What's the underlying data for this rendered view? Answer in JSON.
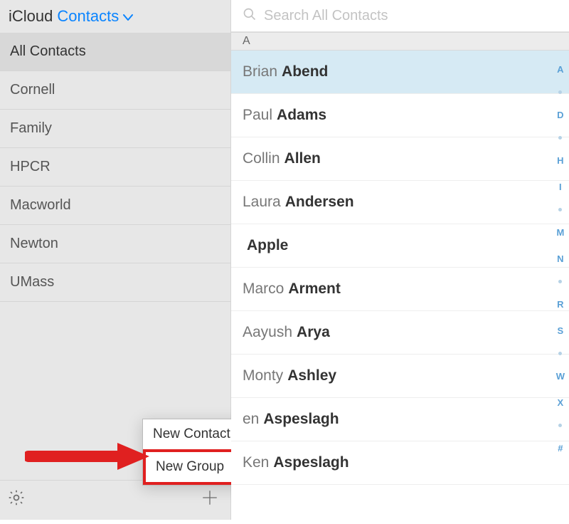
{
  "header": {
    "service": "iCloud",
    "app": "Contacts"
  },
  "search": {
    "placeholder": "Search All Contacts"
  },
  "sidebar": {
    "items": [
      {
        "label": "All Contacts"
      },
      {
        "label": "Cornell"
      },
      {
        "label": "Family"
      },
      {
        "label": "HPCR"
      },
      {
        "label": "Macworld"
      },
      {
        "label": "Newton"
      },
      {
        "label": "UMass"
      }
    ]
  },
  "section_letter": "A",
  "contacts": [
    {
      "first": "Brian",
      "last": "Abend"
    },
    {
      "first": "Paul",
      "last": "Adams"
    },
    {
      "first": "Collin",
      "last": "Allen"
    },
    {
      "first": "Laura",
      "last": "Andersen"
    },
    {
      "first": "",
      "last": "Apple"
    },
    {
      "first": "Marco",
      "last": "Arment"
    },
    {
      "first": "Aayush",
      "last": "Arya"
    },
    {
      "first": "Monty",
      "last": "Ashley"
    },
    {
      "first": "en",
      "last": "Aspeslagh"
    },
    {
      "first": "Ken",
      "last": "Aspeslagh"
    }
  ],
  "index_rail": [
    "A",
    "D",
    "H",
    "I",
    "M",
    "N",
    "R",
    "S",
    "W",
    "X",
    "#"
  ],
  "popup": {
    "items": [
      {
        "label": "New Contact"
      },
      {
        "label": "New Group"
      }
    ]
  }
}
